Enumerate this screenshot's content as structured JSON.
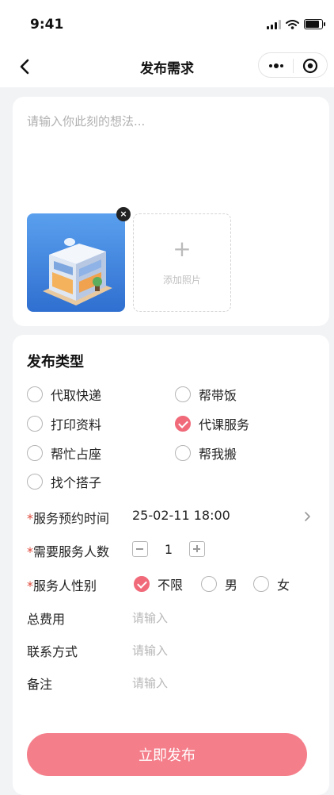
{
  "status": {
    "time": "9:41"
  },
  "nav": {
    "title": "发布需求"
  },
  "post": {
    "placeholder": "请输入你此刻的想法...",
    "add_photo_label": "添加照片",
    "remove_label": "×",
    "add_icon": "+"
  },
  "type_section": {
    "title": "发布类型",
    "options": [
      {
        "label": "代取快递",
        "selected": false
      },
      {
        "label": "帮带饭",
        "selected": false
      },
      {
        "label": "打印资料",
        "selected": false
      },
      {
        "label": "代课服务",
        "selected": true
      },
      {
        "label": "帮忙占座",
        "selected": false
      },
      {
        "label": "帮我搬",
        "selected": false
      },
      {
        "label": "找个搭子",
        "selected": false
      }
    ]
  },
  "form": {
    "required_mark": "*",
    "time": {
      "label": "服务预约时间",
      "value": "25-02-11 18:00"
    },
    "count": {
      "label": "需要服务人数",
      "value": "1"
    },
    "gender": {
      "label": "服务人性别",
      "options": [
        {
          "label": "不限",
          "selected": true
        },
        {
          "label": "男",
          "selected": false
        },
        {
          "label": "女",
          "selected": false
        }
      ]
    },
    "fee": {
      "label": "总费用",
      "placeholder": "请输入"
    },
    "contact": {
      "label": "联系方式",
      "placeholder": "请输入"
    },
    "note": {
      "label": "备注",
      "placeholder": "请输入"
    }
  },
  "submit_label": "立即发布",
  "colors": {
    "accent": "#f06a7a",
    "submit": "#f47f8b",
    "required": "#e04a3c",
    "background": "#f2f3f5"
  },
  "icons": [
    "back-arrow-icon",
    "more-dots-icon",
    "target-close-icon",
    "plus-icon",
    "chevron-right-icon",
    "signal-icon",
    "wifi-icon",
    "battery-icon"
  ]
}
